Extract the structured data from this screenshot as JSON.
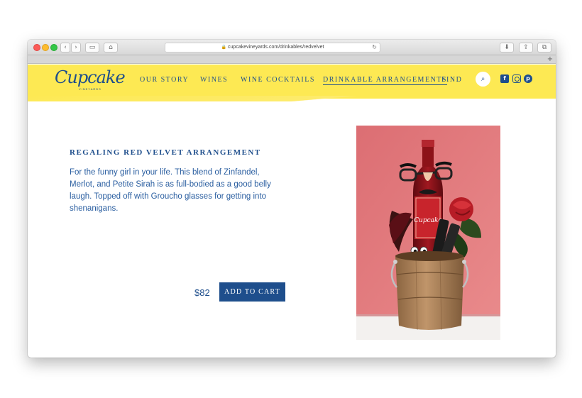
{
  "browser": {
    "url": "cupcakevineyards.com/drinkables/redvelvet",
    "back_glyph": "‹",
    "forward_glyph": "›",
    "sidebar_glyph": "▭",
    "home_glyph": "⌂",
    "lock_glyph": "🔒",
    "reload_glyph": "↻",
    "download_glyph": "⬇",
    "share_glyph": "⇪",
    "tabs_glyph": "⧉",
    "newtab_glyph": "+"
  },
  "site": {
    "logo": {
      "word": "Cupcake",
      "sub": "VINEYARDS"
    },
    "nav": [
      {
        "label": "OUR STORY"
      },
      {
        "label": "WINES"
      },
      {
        "label": "WINE COCKTAILS"
      },
      {
        "label": "DRINKABLE ARRANGEMENTS",
        "active": true
      },
      {
        "label": "FIND"
      }
    ],
    "search_glyph": "⌕",
    "social": {
      "facebook": "f",
      "instagram": "",
      "pinterest": "p"
    },
    "colors": {
      "header_yellow": "#fde953",
      "brand_blue": "#1e4e8c"
    }
  },
  "product": {
    "title": "REGALING RED VELVET ARRANGEMENT",
    "description": "For the funny girl in your life. This blend of Zinfandel, Merlot, and Petite Sirah is as full-bodied as a good belly laugh. Topped off with Groucho glasses for getting into shenanigans.",
    "price": "$82",
    "add_to_cart": "ADD TO CART",
    "image": {
      "bottle_label": "Cupcake",
      "colors": {
        "backdrop": "#e3787b",
        "bucket": "#a77f55",
        "bottle": "#8c1218"
      }
    }
  }
}
